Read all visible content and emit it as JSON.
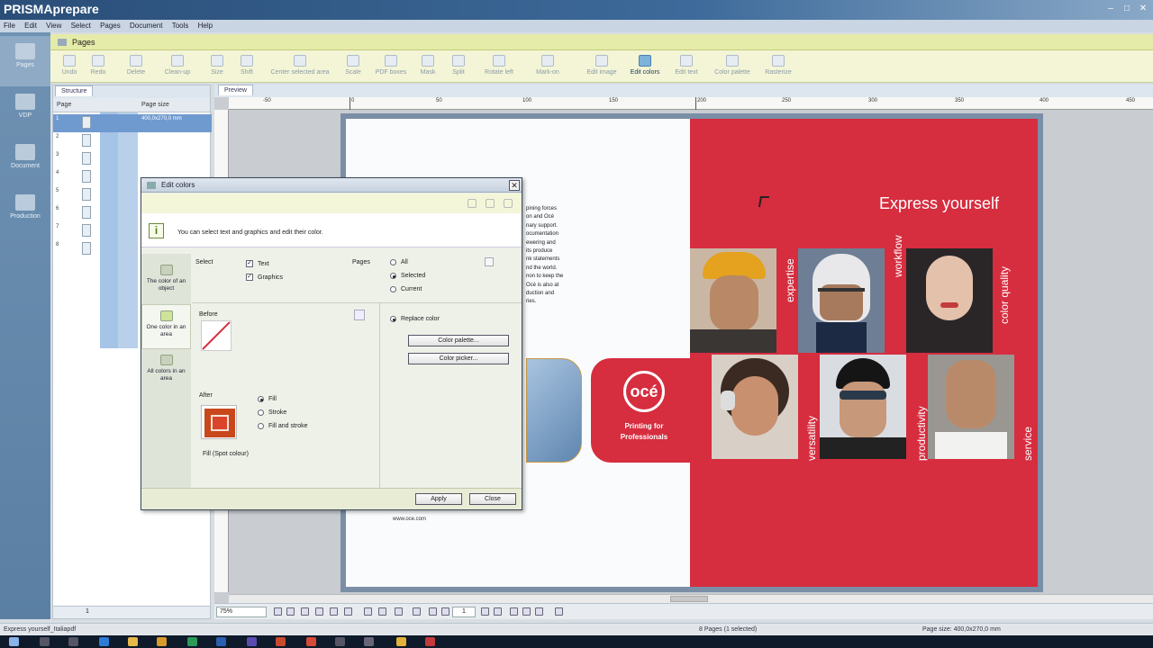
{
  "app": {
    "title": "PRISMAprepare"
  },
  "menu": [
    "File",
    "Edit",
    "View",
    "Select",
    "Pages",
    "Document",
    "Tools",
    "Help"
  ],
  "leftnav": [
    {
      "label": "Pages",
      "icon": "pages-icon"
    },
    {
      "label": "VDP",
      "icon": "vdp-icon"
    },
    {
      "label": "Document",
      "icon": "document-icon"
    },
    {
      "label": "Production",
      "icon": "printer-icon"
    }
  ],
  "ribbon": {
    "tab": "Pages",
    "buttons": [
      {
        "label": "Undo",
        "icon": "undo-icon"
      },
      {
        "label": "Redo",
        "icon": "redo-icon"
      },
      {
        "label": "Delete",
        "icon": "delete-icon"
      },
      {
        "label": "Clean-up",
        "icon": "cleanup-icon"
      },
      {
        "label": "Size",
        "icon": "size-icon"
      },
      {
        "label": "Shift",
        "icon": "shift-icon"
      },
      {
        "label": "Center selected area",
        "icon": "center-icon"
      },
      {
        "label": "Scale",
        "icon": "scale-icon"
      },
      {
        "label": "PDF boxes",
        "icon": "pdf-boxes-icon"
      },
      {
        "label": "Mask",
        "icon": "mask-icon"
      },
      {
        "label": "Split",
        "icon": "split-icon"
      },
      {
        "label": "Rotate left",
        "icon": "rotate-left-icon"
      },
      {
        "label": "Mark-on",
        "icon": "mark-on-icon"
      },
      {
        "label": "Edit image",
        "icon": "edit-image-icon"
      },
      {
        "label": "Edit colors",
        "icon": "edit-colors-icon"
      },
      {
        "label": "Edit text",
        "icon": "edit-text-icon"
      },
      {
        "label": "Color palette",
        "icon": "color-palette-icon"
      },
      {
        "label": "Rasterize",
        "icon": "rasterize-icon"
      }
    ]
  },
  "structure": {
    "tab": "Structure",
    "col_page": "Page",
    "col_size": "Page size",
    "pages": [
      "1",
      "2",
      "3",
      "4",
      "5",
      "6",
      "7",
      "8"
    ],
    "selected_size": "400,0x270,0 mm",
    "bottom_value": "1"
  },
  "preview": {
    "tab": "Preview",
    "ruler_labels": [
      "-50",
      "0",
      "50",
      "100",
      "150",
      "200",
      "250",
      "300",
      "350",
      "400",
      "450"
    ],
    "zoom": "75%",
    "page_field": "1"
  },
  "document": {
    "headline": "Express yourself",
    "words": [
      "expertise",
      "workflow",
      "color quality",
      "versatility",
      "productivity",
      "service"
    ],
    "oce_logo": "océ",
    "tagline": [
      "Printing for",
      "Professionals"
    ],
    "body_text": [
      "pining forces",
      "on and Océ",
      "nary support.",
      "ocumentation",
      "ewering and",
      "its produce",
      "nk statements",
      "nd the world.",
      "non to keep the",
      "Océ is also at",
      "duction and",
      "ries."
    ],
    "url": "www.oce.com"
  },
  "dialog": {
    "title": "Edit colors",
    "info": "You can select text and graphics and edit their color.",
    "side_options": [
      "The color of an object",
      "One color in an area",
      "All colors in an area"
    ],
    "select_label": "Select",
    "select_text": "Text",
    "select_graphics": "Graphics",
    "pages_label": "Pages",
    "pages_all": "All",
    "pages_selected": "Selected",
    "pages_current": "Current",
    "before_label": "Before",
    "replace_color": "Replace color",
    "color_palette_btn": "Color palette...",
    "color_picker_btn": "Color picker...",
    "after_label": "After",
    "fill": "Fill",
    "stroke": "Stroke",
    "fill_and_stroke": "Fill and stroke",
    "swatch_caption": "Fill (Spot colour)",
    "apply": "Apply",
    "close": "Close"
  },
  "status": {
    "file": "Express yourself_Italiapdf",
    "pages": "8 Pages (1 selected)",
    "page_size": "Page size: 400,0x270,0 mm"
  },
  "colors": {
    "doc_red": "#d62d3f",
    "ribbon_bg": "#f3f5d6",
    "select_blue": "#6f9ad0",
    "swatch": "#c8481c"
  }
}
